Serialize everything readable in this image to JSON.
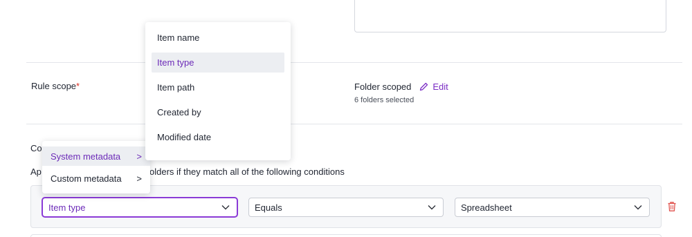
{
  "rule_scope": {
    "label": "Rule scope",
    "required_mark": "*",
    "value": "Folder scoped",
    "edit_label": "Edit",
    "subtext": "6 folders selected"
  },
  "conditions": {
    "label_partial": "Co",
    "description_prefix": "Ap",
    "description_rest": "olders if they match all of the following conditions",
    "row": {
      "field": "Item type",
      "operator": "Equals",
      "value": "Spreadsheet"
    }
  },
  "field_menu": {
    "items": [
      "Item name",
      "Item type",
      "Item path",
      "Created by",
      "Modified date"
    ],
    "selected": "Item type"
  },
  "category_menu": {
    "items": [
      {
        "label": "System metadata",
        "chevron": ">"
      },
      {
        "label": "Custom metadata",
        "chevron": ">"
      }
    ],
    "selected": "System metadata"
  },
  "colors": {
    "accent": "#7a2bc4",
    "required": "#d92d20",
    "delete": "#e0524d"
  },
  "icons": {
    "edit": "pencil-icon",
    "delete": "trash-icon",
    "dropdown": "chevron-down-icon"
  }
}
